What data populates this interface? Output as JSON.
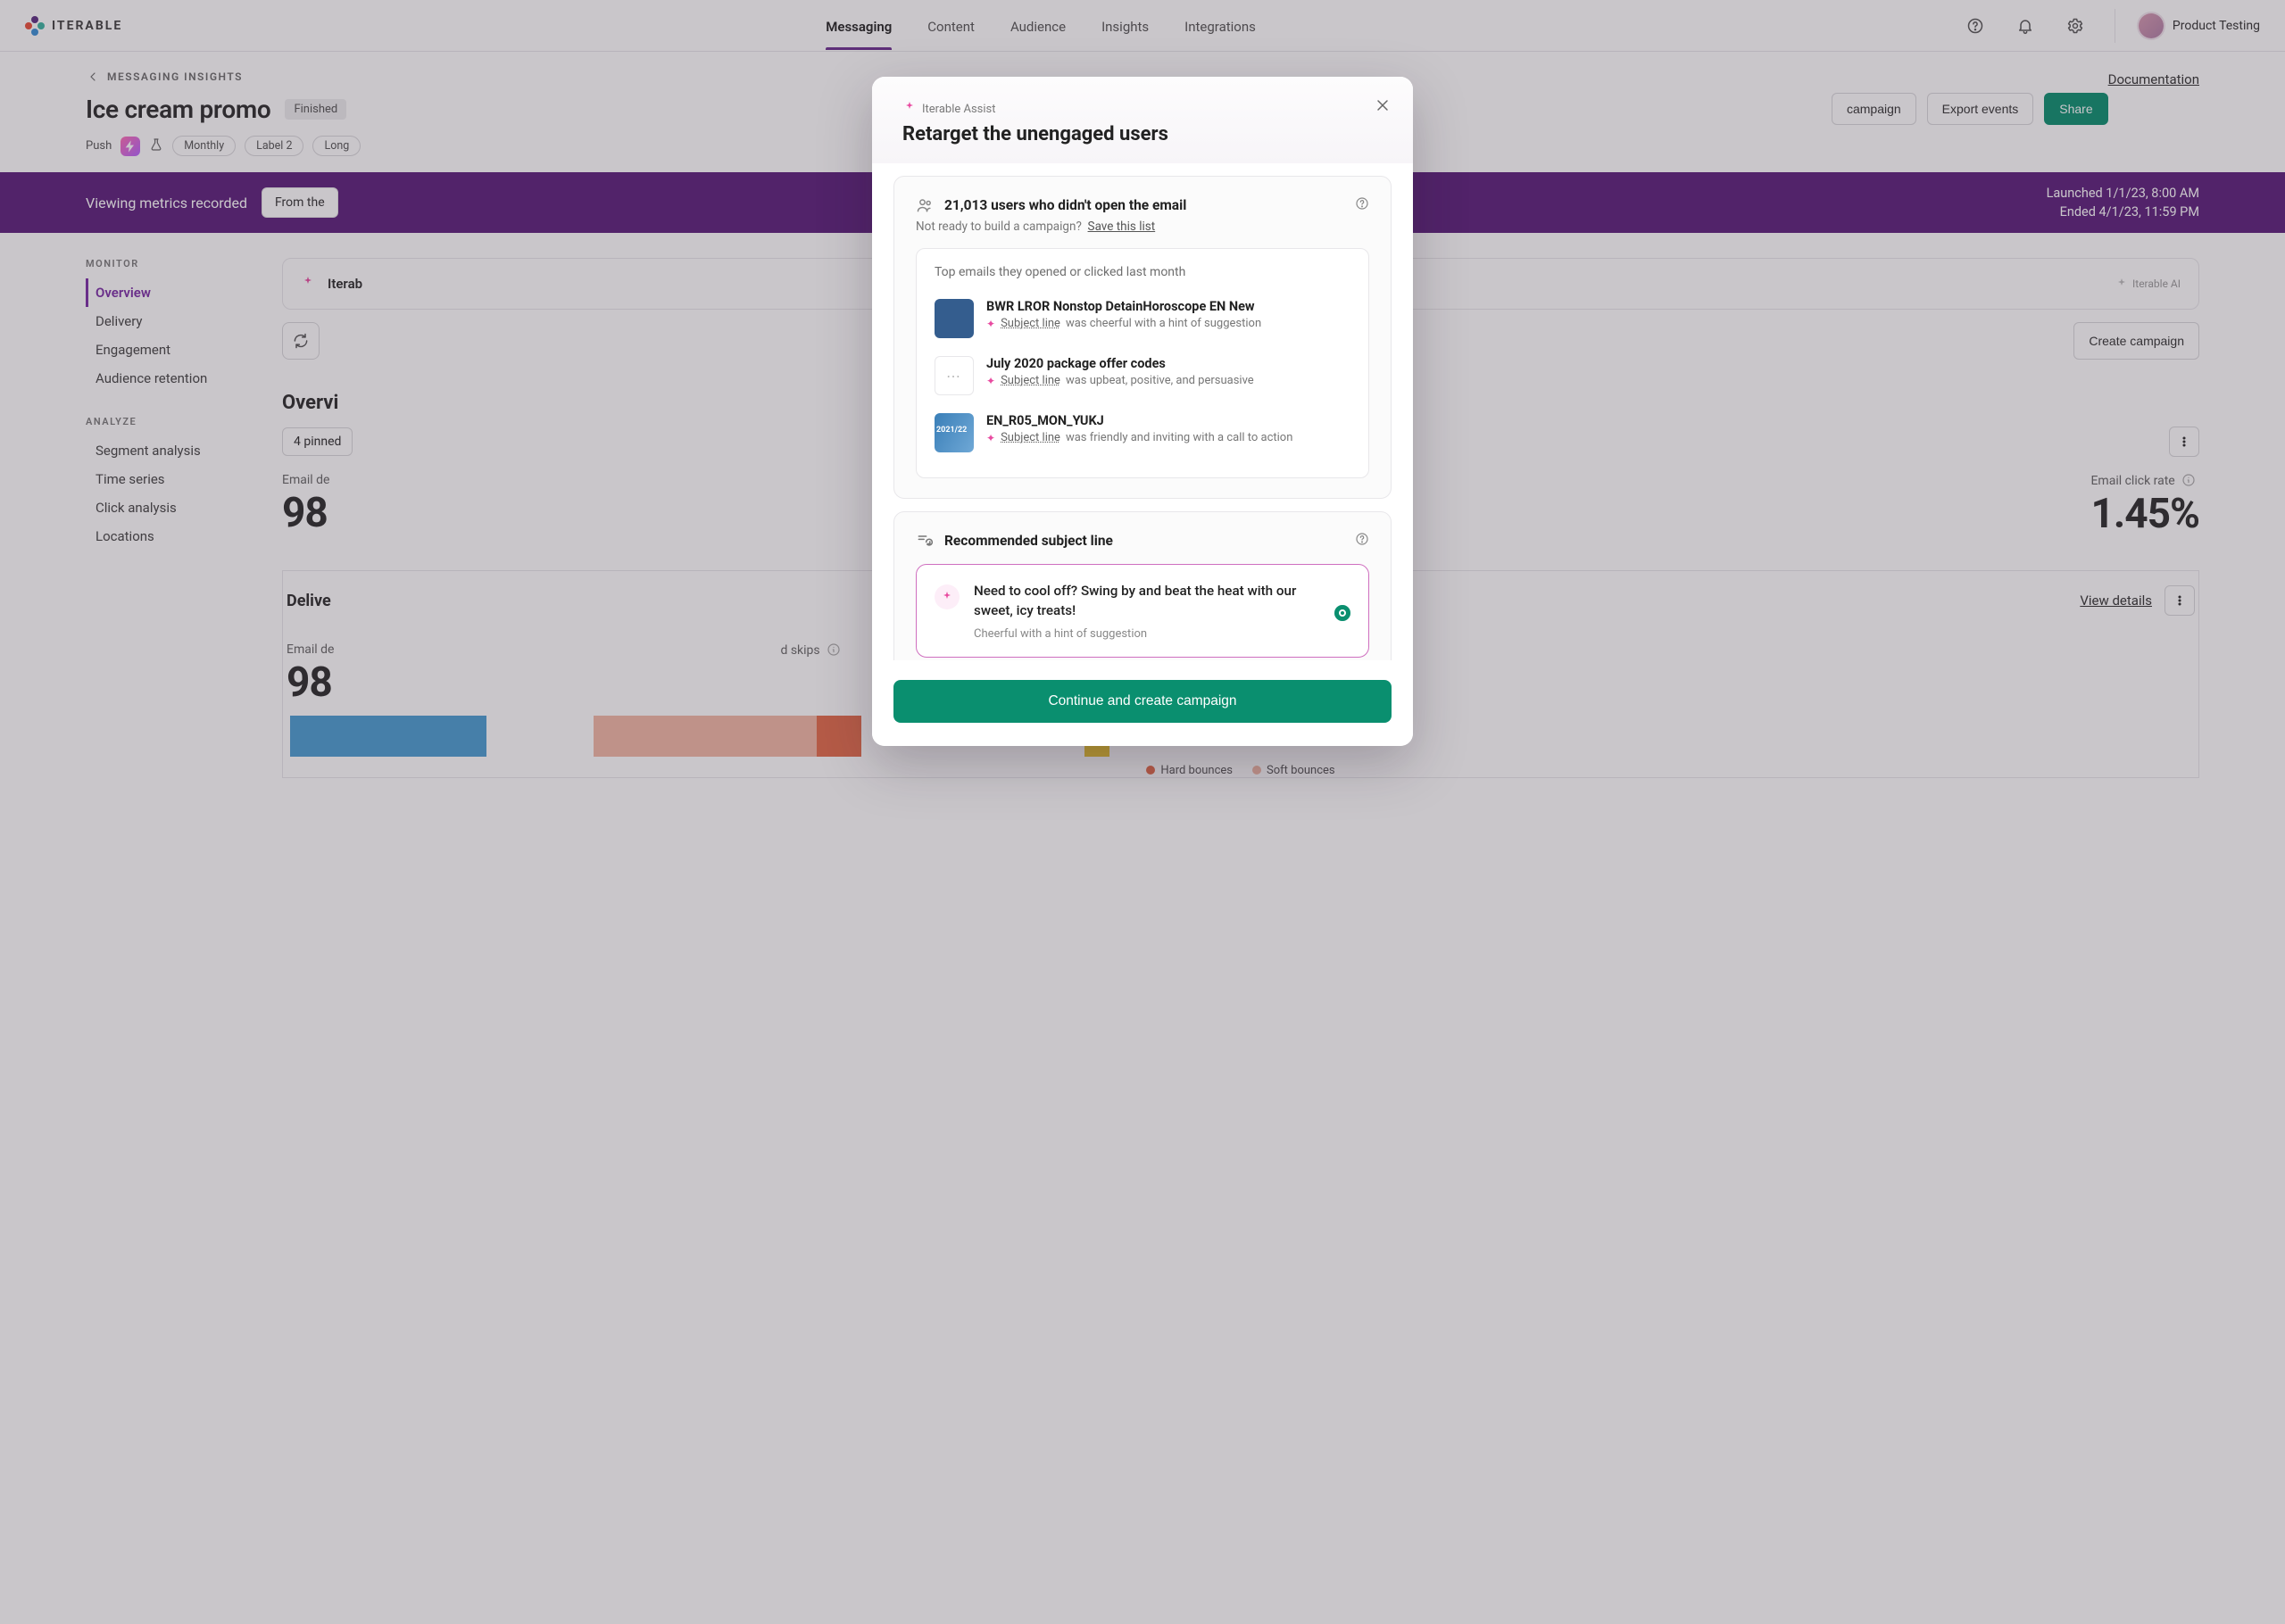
{
  "brand": {
    "name": "ITERABLE"
  },
  "nav": {
    "items": [
      "Messaging",
      "Content",
      "Audience",
      "Insights",
      "Integrations"
    ],
    "active": 0,
    "user_label": "Product Testing"
  },
  "page": {
    "back_label": "MESSAGING INSIGHTS",
    "title": "Ice cream promo",
    "status": "Finished",
    "doc_link": "Documentation",
    "actions": {
      "campaign": "campaign",
      "export": "Export events",
      "share": "Share"
    },
    "tags": {
      "channel": "Push",
      "cadence": "Monthly",
      "label": "Label 2",
      "long": "Long"
    }
  },
  "banner": {
    "label": "Viewing metrics recorded",
    "range": "From the",
    "launched": "Launched 1/1/23, 8:00 AM",
    "ended": "Ended 4/1/23, 11:59 PM"
  },
  "sidebar": {
    "monitor_h": "MONITOR",
    "monitor": [
      "Overview",
      "Delivery",
      "Engagement",
      "Audience retention"
    ],
    "analyze_h": "ANALYZE",
    "analyze": [
      "Segment analysis",
      "Time series",
      "Click analysis",
      "Locations"
    ]
  },
  "assist_strip": {
    "label": "Iterab",
    "ai": "Iterable AI",
    "create": "Create campaign"
  },
  "overview": {
    "heading": "Overvi",
    "pinned": "4 pinned",
    "metrics": {
      "delivered_label": "Email de",
      "delivered_value": "98",
      "click_label": "Email click rate",
      "click_value": "1.45%"
    }
  },
  "delivery": {
    "heading": "Delive",
    "view": "View details",
    "m1_label": "Email de",
    "m1_value": "98",
    "m2_label": "d skips",
    "legend_hard": "Hard bounces",
    "legend_soft": "Soft bounces"
  },
  "modal": {
    "eyebrow": "Iterable Assist",
    "title": "Retarget the unengaged users",
    "audience": {
      "heading": "21,013 users who didn't open the email",
      "sub_prefix": "Not ready to build a campaign?",
      "sub_link": "Save this list",
      "top_hint": "Top emails they opened or clicked last month",
      "subject_label": "Subject line",
      "emails": [
        {
          "title": "BWR LROR Nonstop DetainHoroscope EN New",
          "tone": "was cheerful with a hint of suggestion"
        },
        {
          "title": "July 2020 package offer codes",
          "tone": "was upbeat, positive, and persuasive"
        },
        {
          "title": "EN_R05_MON_YUKJ",
          "tone": "was friendly and inviting with a call to action"
        }
      ]
    },
    "reco": {
      "heading": "Recommended subject line",
      "option_text": "Need to cool off? Swing by and beat the heat with our sweet, icy treats!",
      "option_tone": "Cheerful with a hint of suggestion"
    },
    "cta": "Continue and create campaign"
  }
}
